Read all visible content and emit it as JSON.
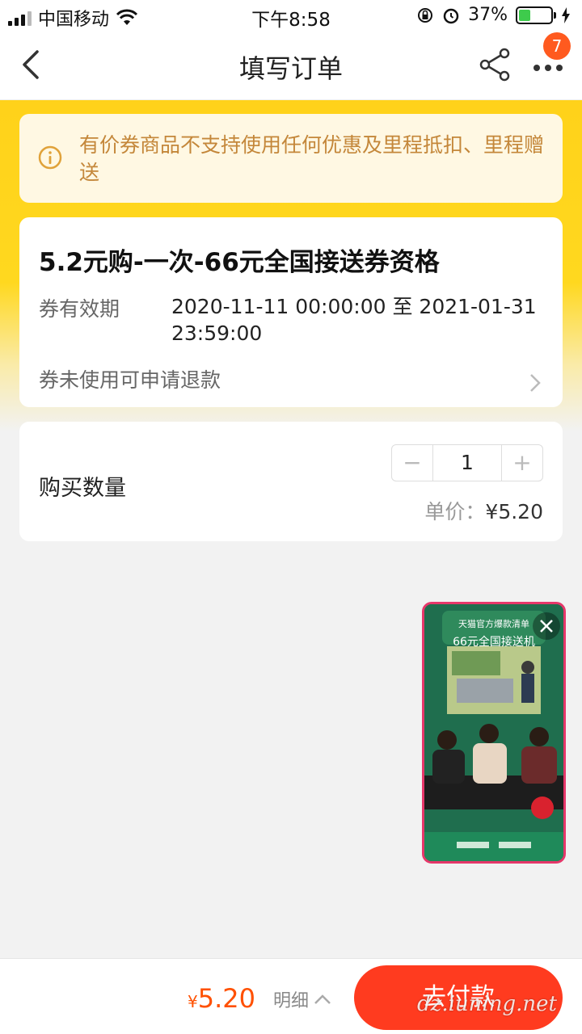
{
  "status_bar": {
    "carrier": "中国移动",
    "time": "下午8:58",
    "battery_percent": "37%",
    "battery_level": 0.37,
    "battery_color": "#3ecb4c"
  },
  "nav": {
    "title": "填写订单",
    "back_icon": "chevron-left-icon",
    "share_icon": "share-icon",
    "more_icon": "more-icon",
    "badge_count": "7",
    "badge_color": "#ff5a1f"
  },
  "notice": {
    "icon": "info-icon",
    "text": "有价券商品不支持使用任何优惠及里程抵扣、里程赠送"
  },
  "product": {
    "title": "5.2元购-一次-66元全国接送券资格",
    "validity_label": "券有效期",
    "validity_value": "2020-11-11 00:00:00 至 2021-01-31 23:59:00",
    "refund_label": "券未使用可申请退款"
  },
  "quantity": {
    "label": "购买数量",
    "minus": "−",
    "value": "1",
    "plus": "+",
    "unit_price_label": "单价：",
    "unit_price_value": "¥5.20"
  },
  "video": {
    "heading": "天猫官方爆款清单",
    "subheading": "66元全国接送机",
    "close_icon": "close-icon",
    "border_color": "#e6376a"
  },
  "footer": {
    "currency": "¥",
    "total": "5.20",
    "detail_label": "明细",
    "detail_icon": "chevron-up-icon",
    "pay_label": "去付款",
    "accent_color": "#ff3b1f",
    "watermark": "dz.iuning.net"
  }
}
